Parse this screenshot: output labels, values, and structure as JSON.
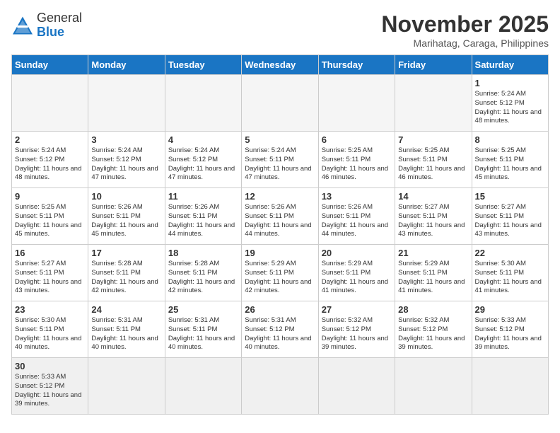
{
  "header": {
    "logo_general": "General",
    "logo_blue": "Blue",
    "month_title": "November 2025",
    "location": "Marihatag, Caraga, Philippines"
  },
  "days_of_week": [
    "Sunday",
    "Monday",
    "Tuesday",
    "Wednesday",
    "Thursday",
    "Friday",
    "Saturday"
  ],
  "weeks": [
    [
      {
        "day": "",
        "info": ""
      },
      {
        "day": "",
        "info": ""
      },
      {
        "day": "",
        "info": ""
      },
      {
        "day": "",
        "info": ""
      },
      {
        "day": "",
        "info": ""
      },
      {
        "day": "",
        "info": ""
      },
      {
        "day": "1",
        "info": "Sunrise: 5:24 AM\nSunset: 5:12 PM\nDaylight: 11 hours\nand 48 minutes."
      }
    ],
    [
      {
        "day": "2",
        "info": "Sunrise: 5:24 AM\nSunset: 5:12 PM\nDaylight: 11 hours\nand 48 minutes."
      },
      {
        "day": "3",
        "info": "Sunrise: 5:24 AM\nSunset: 5:12 PM\nDaylight: 11 hours\nand 47 minutes."
      },
      {
        "day": "4",
        "info": "Sunrise: 5:24 AM\nSunset: 5:12 PM\nDaylight: 11 hours\nand 47 minutes."
      },
      {
        "day": "5",
        "info": "Sunrise: 5:24 AM\nSunset: 5:11 PM\nDaylight: 11 hours\nand 47 minutes."
      },
      {
        "day": "6",
        "info": "Sunrise: 5:25 AM\nSunset: 5:11 PM\nDaylight: 11 hours\nand 46 minutes."
      },
      {
        "day": "7",
        "info": "Sunrise: 5:25 AM\nSunset: 5:11 PM\nDaylight: 11 hours\nand 46 minutes."
      },
      {
        "day": "8",
        "info": "Sunrise: 5:25 AM\nSunset: 5:11 PM\nDaylight: 11 hours\nand 45 minutes."
      }
    ],
    [
      {
        "day": "9",
        "info": "Sunrise: 5:25 AM\nSunset: 5:11 PM\nDaylight: 11 hours\nand 45 minutes."
      },
      {
        "day": "10",
        "info": "Sunrise: 5:26 AM\nSunset: 5:11 PM\nDaylight: 11 hours\nand 45 minutes."
      },
      {
        "day": "11",
        "info": "Sunrise: 5:26 AM\nSunset: 5:11 PM\nDaylight: 11 hours\nand 44 minutes."
      },
      {
        "day": "12",
        "info": "Sunrise: 5:26 AM\nSunset: 5:11 PM\nDaylight: 11 hours\nand 44 minutes."
      },
      {
        "day": "13",
        "info": "Sunrise: 5:26 AM\nSunset: 5:11 PM\nDaylight: 11 hours\nand 44 minutes."
      },
      {
        "day": "14",
        "info": "Sunrise: 5:27 AM\nSunset: 5:11 PM\nDaylight: 11 hours\nand 43 minutes."
      },
      {
        "day": "15",
        "info": "Sunrise: 5:27 AM\nSunset: 5:11 PM\nDaylight: 11 hours\nand 43 minutes."
      }
    ],
    [
      {
        "day": "16",
        "info": "Sunrise: 5:27 AM\nSunset: 5:11 PM\nDaylight: 11 hours\nand 43 minutes."
      },
      {
        "day": "17",
        "info": "Sunrise: 5:28 AM\nSunset: 5:11 PM\nDaylight: 11 hours\nand 42 minutes."
      },
      {
        "day": "18",
        "info": "Sunrise: 5:28 AM\nSunset: 5:11 PM\nDaylight: 11 hours\nand 42 minutes."
      },
      {
        "day": "19",
        "info": "Sunrise: 5:29 AM\nSunset: 5:11 PM\nDaylight: 11 hours\nand 42 minutes."
      },
      {
        "day": "20",
        "info": "Sunrise: 5:29 AM\nSunset: 5:11 PM\nDaylight: 11 hours\nand 41 minutes."
      },
      {
        "day": "21",
        "info": "Sunrise: 5:29 AM\nSunset: 5:11 PM\nDaylight: 11 hours\nand 41 minutes."
      },
      {
        "day": "22",
        "info": "Sunrise: 5:30 AM\nSunset: 5:11 PM\nDaylight: 11 hours\nand 41 minutes."
      }
    ],
    [
      {
        "day": "23",
        "info": "Sunrise: 5:30 AM\nSunset: 5:11 PM\nDaylight: 11 hours\nand 40 minutes."
      },
      {
        "day": "24",
        "info": "Sunrise: 5:31 AM\nSunset: 5:11 PM\nDaylight: 11 hours\nand 40 minutes."
      },
      {
        "day": "25",
        "info": "Sunrise: 5:31 AM\nSunset: 5:11 PM\nDaylight: 11 hours\nand 40 minutes."
      },
      {
        "day": "26",
        "info": "Sunrise: 5:31 AM\nSunset: 5:12 PM\nDaylight: 11 hours\nand 40 minutes."
      },
      {
        "day": "27",
        "info": "Sunrise: 5:32 AM\nSunset: 5:12 PM\nDaylight: 11 hours\nand 39 minutes."
      },
      {
        "day": "28",
        "info": "Sunrise: 5:32 AM\nSunset: 5:12 PM\nDaylight: 11 hours\nand 39 minutes."
      },
      {
        "day": "29",
        "info": "Sunrise: 5:33 AM\nSunset: 5:12 PM\nDaylight: 11 hours\nand 39 minutes."
      }
    ],
    [
      {
        "day": "30",
        "info": "Sunrise: 5:33 AM\nSunset: 5:12 PM\nDaylight: 11 hours\nand 39 minutes."
      },
      {
        "day": "",
        "info": ""
      },
      {
        "day": "",
        "info": ""
      },
      {
        "day": "",
        "info": ""
      },
      {
        "day": "",
        "info": ""
      },
      {
        "day": "",
        "info": ""
      },
      {
        "day": "",
        "info": ""
      }
    ]
  ]
}
